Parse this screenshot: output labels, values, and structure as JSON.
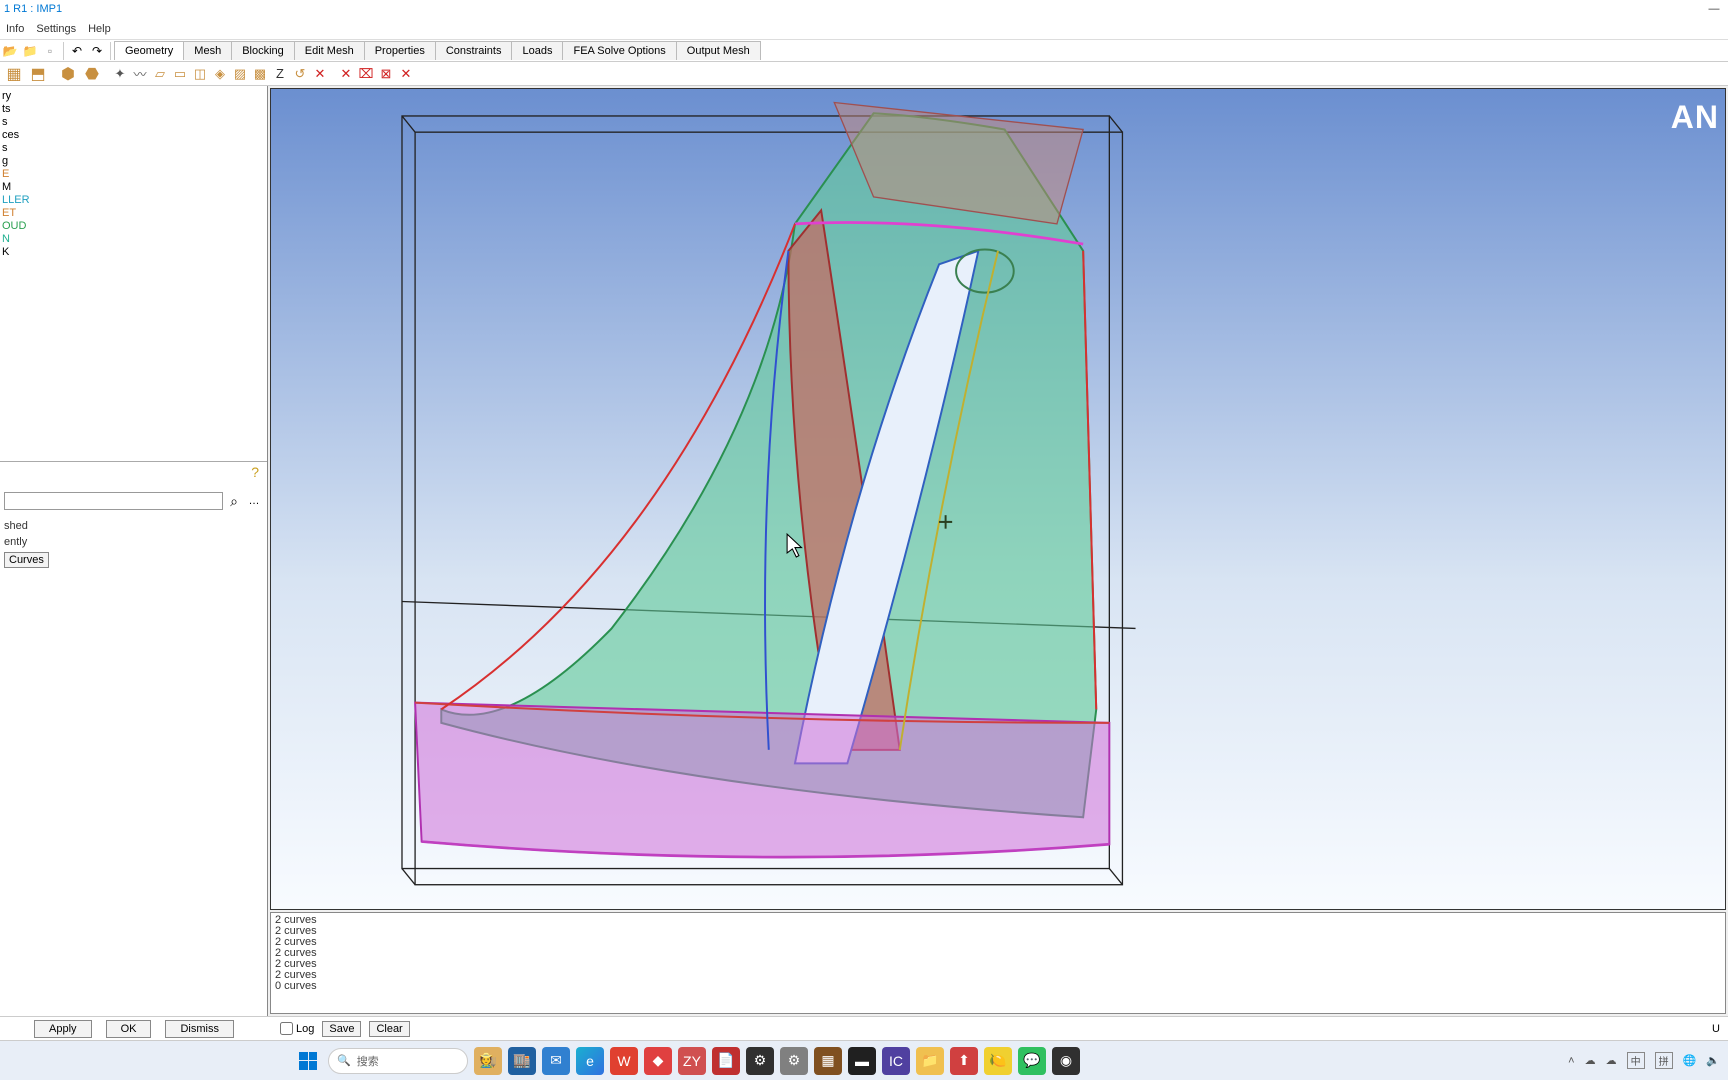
{
  "title": "1 R1 : IMP1",
  "brand_text": "AN",
  "menubar": [
    "Info",
    "Settings",
    "Help"
  ],
  "tabs": [
    "Geometry",
    "Mesh",
    "Blocking",
    "Edit Mesh",
    "Properties",
    "Constraints",
    "Loads",
    "FEA Solve Options",
    "Output Mesh"
  ],
  "active_tab_index": 0,
  "tree": [
    {
      "label": "ry",
      "class": ""
    },
    {
      "label": "ts",
      "class": ""
    },
    {
      "label": "s",
      "class": ""
    },
    {
      "label": "ces",
      "class": ""
    },
    {
      "label": "s",
      "class": ""
    },
    {
      "label": "g",
      "class": ""
    },
    {
      "label": "",
      "class": ""
    },
    {
      "label": "E",
      "class": "orange"
    },
    {
      "label": "M",
      "class": ""
    },
    {
      "label": "",
      "class": ""
    },
    {
      "label": "LLER",
      "class": "cyan"
    },
    {
      "label": "",
      "class": ""
    },
    {
      "label": "ET",
      "class": "orange"
    },
    {
      "label": "OUD",
      "class": "green"
    },
    {
      "label": "N",
      "class": "teal"
    },
    {
      "label": "K",
      "class": ""
    }
  ],
  "props": {
    "label1": "shed",
    "label2": "ently",
    "curves_btn": "Curves"
  },
  "console_lines": [
    "2 curves",
    "2 curves",
    "2 curves",
    "2 curves",
    "2 curves",
    "2 curves",
    "0 curves"
  ],
  "bottom_buttons": {
    "apply": "Apply",
    "ok": "OK",
    "dismiss": "Dismiss"
  },
  "log_row": {
    "log": "Log",
    "save": "Save",
    "clear": "Clear",
    "right_char": "U"
  },
  "taskbar": {
    "search_placeholder": "搜索",
    "tray": {
      "ime1": "中",
      "ime2": "拼"
    }
  }
}
